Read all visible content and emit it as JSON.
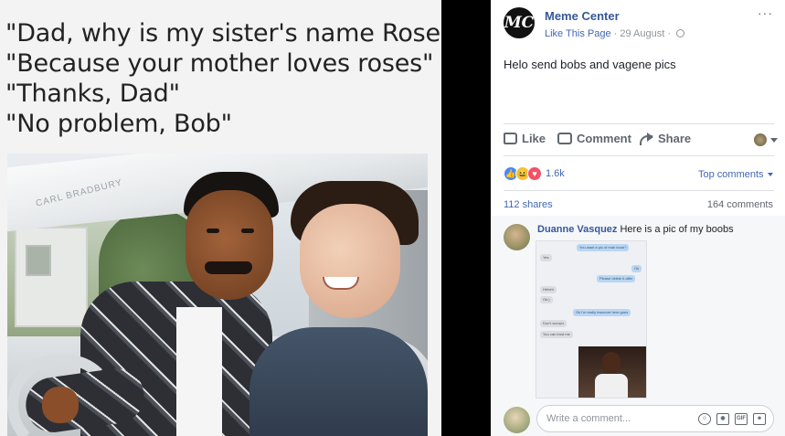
{
  "meme": {
    "lines": [
      "\"Dad, why is my sister's name Rose?\"",
      "\"Because your mother loves roses\"",
      "\"Thanks, Dad\"",
      "\"No problem, Bob\""
    ],
    "car_label": "CARL BRADBURY"
  },
  "post": {
    "avatar_text": "MC",
    "page_name": "Meme Center",
    "like_page": "Like This Page",
    "date": "29 August",
    "text": "Helo send bobs and vagene pics",
    "actions": {
      "like": "Like",
      "comment": "Comment",
      "share": "Share"
    },
    "reaction_count": "1.6k",
    "top_comments": "Top comments",
    "shares": "112 shares",
    "comments": "164 comments",
    "comment": {
      "author": "Duanne Vasquez",
      "text": "Here is a pic of my boobs",
      "chat": [
        {
          "side": "right",
          "text": "You want a pic of mah boob?"
        },
        {
          "side": "left",
          "text": "Yes"
        },
        {
          "side": "right",
          "text": "Ok"
        },
        {
          "side": "right",
          "text": "Please delete it after"
        },
        {
          "side": "left",
          "text": "Heheh"
        },
        {
          "side": "left",
          "text": "Ok:)"
        },
        {
          "side": "right",
          "text": "Ok I'm really insecure here goes"
        },
        {
          "side": "left",
          "text": "Don't worry!x"
        },
        {
          "side": "left",
          "text": "You can trust me"
        }
      ]
    },
    "write_placeholder": "Write a comment...",
    "write_icons": [
      "emoji-icon",
      "camera-icon",
      "gif-icon",
      "sticker-icon"
    ],
    "colors": {
      "link": "#365899",
      "accent": "#4267b2",
      "muted": "#90949c"
    }
  }
}
